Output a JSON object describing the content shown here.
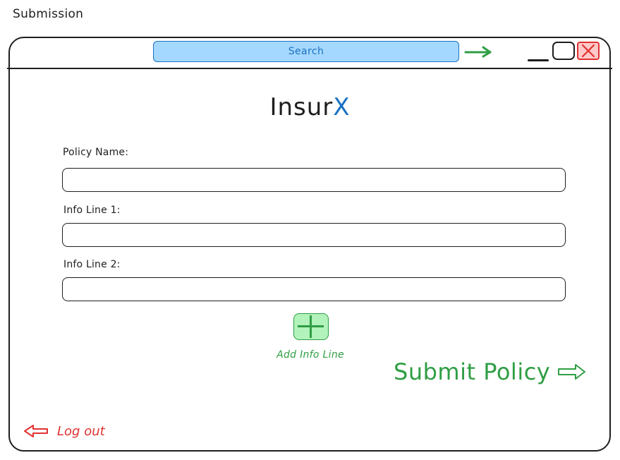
{
  "page_label": "Submission",
  "window": {
    "search": {
      "label": "Search"
    },
    "controls": [
      "minimize",
      "maximize",
      "close"
    ]
  },
  "app": {
    "title_main": "Insur",
    "title_accent": "X",
    "accent_color": "#1971c2"
  },
  "form": {
    "fields": [
      {
        "label": "Policy Name:",
        "value": ""
      },
      {
        "label": "Info Line 1:",
        "value": ""
      },
      {
        "label": "Info Line 2:",
        "value": ""
      }
    ],
    "add_info_label": "Add Info Line",
    "submit_label": "Submit Policy"
  },
  "footer": {
    "logout_label": "Log out"
  },
  "colors": {
    "search_fill": "#a5d8ff",
    "positive": "#2f9e44",
    "positive_fill": "#b2f2bb",
    "danger": "#e03131",
    "danger_fill": "#ffc9c9"
  },
  "icons": {
    "go": "arrow-right-icon",
    "add": "plus-icon",
    "submit": "hollow-arrow-right-icon",
    "logout": "hollow-arrow-left-icon"
  }
}
